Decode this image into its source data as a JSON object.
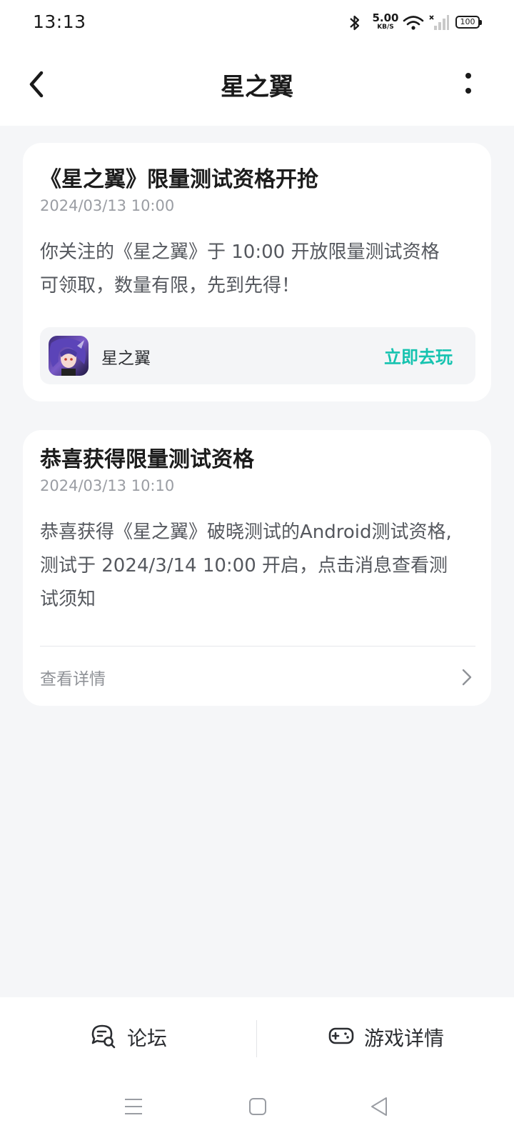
{
  "status_bar": {
    "time": "13:13",
    "net_speed_value": "5.00",
    "net_speed_unit": "KB/S",
    "battery": "100",
    "icons": [
      "bluetooth-icon",
      "wifi-icon",
      "signal-icon",
      "battery-icon"
    ]
  },
  "header": {
    "title": "星之翼",
    "back_icon": "back-icon",
    "more_icon": "more-icon"
  },
  "messages": [
    {
      "title": "《星之翼》限量测试资格开抢",
      "time": "2024/03/13 10:00",
      "body_line1": "你关注的《星之翼》于 10:00 开放限量测试资格",
      "body_line2": "可领取，数量有限，先到先得！",
      "game": {
        "name": "星之翼",
        "action": "立即去玩",
        "icon": "game-app-icon"
      }
    },
    {
      "title": "恭喜获得限量测试资格",
      "time": "2024/03/13 10:10",
      "body_line1": "恭喜获得《星之翼》破晓测试的Android测试资格,",
      "body_line2": "测试于 2024/3/14 10:00 开启，点击消息查看测",
      "body_line3": "试须知",
      "link_label": "查看详情"
    }
  ],
  "bottom_bar": {
    "forum_label": "论坛",
    "game_detail_label": "游戏详情"
  },
  "colors": {
    "accent": "#16c3b0",
    "background": "#f5f6f8",
    "card": "#ffffff"
  }
}
